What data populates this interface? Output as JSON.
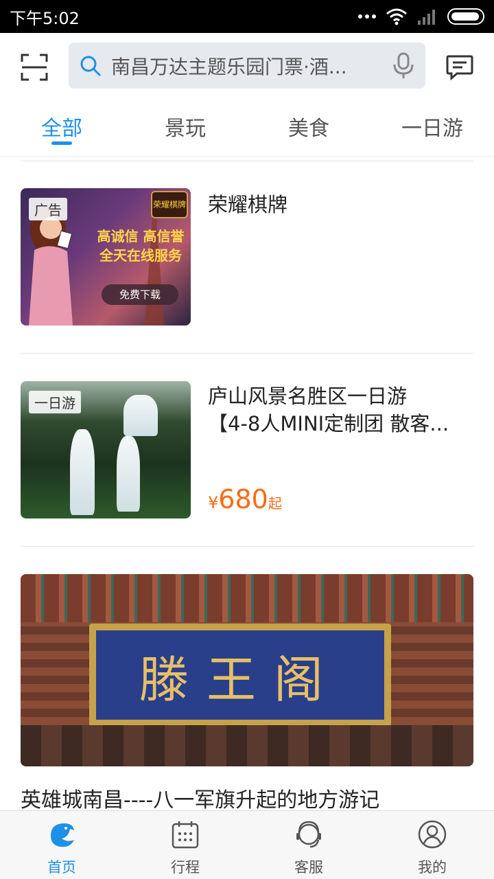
{
  "status_bar": {
    "time": "下午5:02"
  },
  "search": {
    "placeholder": "南昌万达主题乐园门票·酒..."
  },
  "tabs": [
    {
      "label": "全部",
      "active": true
    },
    {
      "label": "景玩",
      "active": false
    },
    {
      "label": "美食",
      "active": false
    },
    {
      "label": "一日游",
      "active": false
    }
  ],
  "feed": {
    "ad": {
      "tag": "广告",
      "title": "荣耀棋牌",
      "image_slogan": "高诚信 高信誉 全天在线服务",
      "image_button": "免费下载",
      "image_logo": "荣耀棋牌"
    },
    "tour": {
      "tag": "一日游",
      "title_line1": "庐山风景名胜区一日游",
      "title_line2": "【4-8人MINI定制团 散客...",
      "price_symbol": "¥",
      "price": "680",
      "price_suffix": "起"
    },
    "article": {
      "plaque_text": "滕王阁",
      "title": "英雄城南昌----八一军旗升起的地方游记"
    }
  },
  "bottom_nav": [
    {
      "label": "首页",
      "icon": "dolphin-home-icon",
      "active": true
    },
    {
      "label": "行程",
      "icon": "calendar-icon",
      "active": false
    },
    {
      "label": "客服",
      "icon": "headset-icon",
      "active": false
    },
    {
      "label": "我的",
      "icon": "user-icon",
      "active": false
    }
  ],
  "colors": {
    "accent": "#1e90e6",
    "price": "#ff6a13"
  }
}
